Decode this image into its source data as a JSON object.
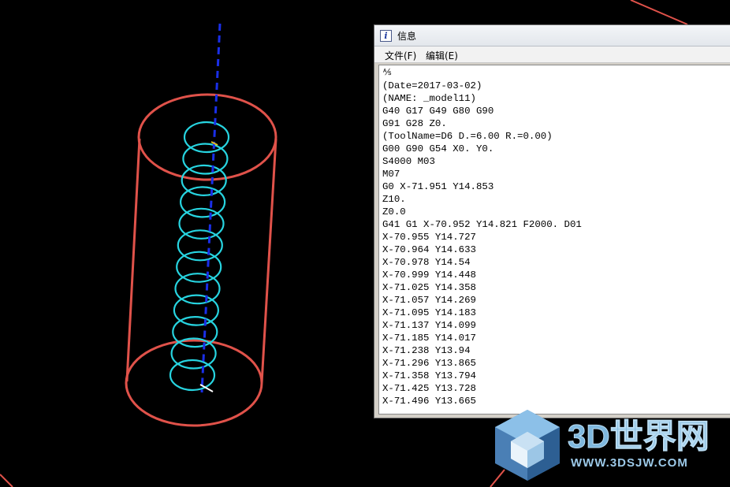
{
  "window": {
    "icon": "info-icon",
    "title": "信息",
    "menu": [
      {
        "label": "文件(F)"
      },
      {
        "label": "编辑(E)"
      }
    ]
  },
  "content": {
    "cursor_glyph": "⅍",
    "lines": [
      "(Date=2017-03-02)",
      "(NAME: _model11)",
      "G40 G17 G49 G80 G90",
      "G91 G28 Z0.",
      "(ToolName=D6 D.=6.00 R.=0.00)",
      "G00 G90 G54 X0. Y0.",
      "S4000 M03",
      "M07",
      "G0 X-71.951 Y14.853",
      "Z10.",
      "Z0.0",
      "G41 G1 X-70.952 Y14.821 F2000. D01",
      "X-70.955 Y14.727",
      "X-70.964 Y14.633",
      "X-70.978 Y14.54",
      "X-70.999 Y14.448",
      "X-71.025 Y14.358",
      "X-71.057 Y14.269",
      "X-71.095 Y14.183",
      "X-71.137 Y14.099",
      "X-71.185 Y14.017",
      "X-71.238 Y13.94",
      "X-71.296 Y13.865",
      "X-71.358 Y13.794",
      "X-71.425 Y13.728",
      "X-71.496 Y13.665"
    ]
  },
  "watermark": {
    "brand": "3D世界网",
    "url": "WWW.3DSJW.COM",
    "icon": "cube-logo-icon"
  },
  "colors": {
    "background": "#000000",
    "cylinder": "#e0524a",
    "helix": "#27d4e0",
    "axis": "#1a2fe8",
    "watermark": "#7fb8de"
  }
}
